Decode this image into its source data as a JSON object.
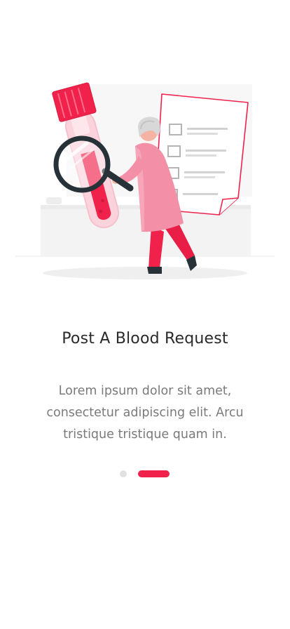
{
  "onboarding": {
    "title": "Post A Blood Request",
    "description": "Lorem ipsum dolor sit amet, consectetur adipiscing elit. Arcu tristique tristique quam in.",
    "illustration_icon": "blood-test-doctor-illustration",
    "pagination": {
      "total_pages": 2,
      "current_page": 2
    }
  },
  "colors": {
    "accent": "#f0224c",
    "title_text": "#2a2a2a",
    "body_text": "#7a7a7a",
    "inactive_dot": "#e0e0e0",
    "background": "#ffffff"
  }
}
